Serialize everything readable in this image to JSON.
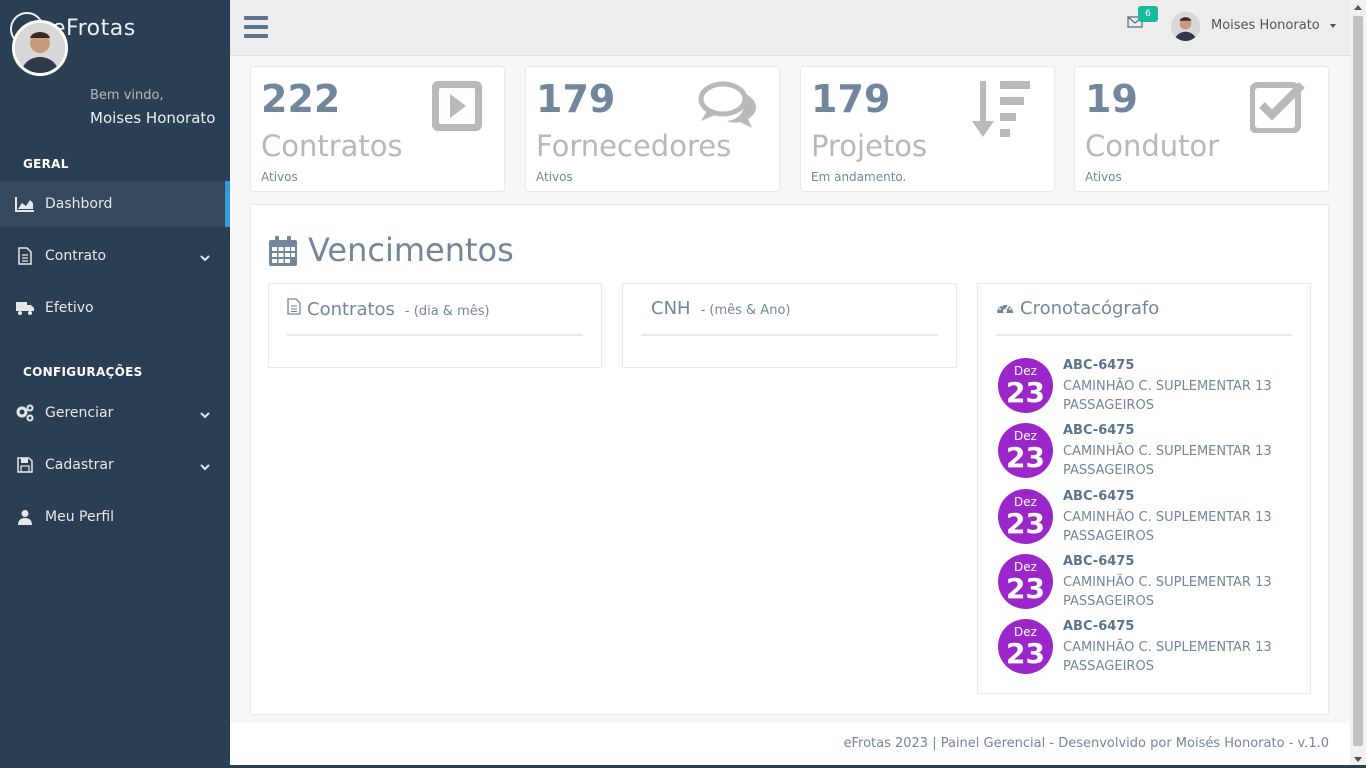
{
  "brand": {
    "name": "eFrotas"
  },
  "profile": {
    "welcome": "Bem vindo,",
    "name": "Moises Honorato"
  },
  "sidebar": {
    "sections": [
      {
        "title": "GERAL"
      },
      {
        "title": "CONFIGURAÇÕES"
      }
    ],
    "items": [
      {
        "label": "Dashbord",
        "icon": "area-chart-icon",
        "active": true
      },
      {
        "label": "Contrato",
        "icon": "file-icon",
        "has_submenu": true
      },
      {
        "label": "Efetivo",
        "icon": "truck-icon"
      },
      {
        "label": "Gerenciar",
        "icon": "cogs-icon",
        "has_submenu": true
      },
      {
        "label": "Cadastrar",
        "icon": "floppy-icon",
        "has_submenu": true
      },
      {
        "label": "Meu Perfil",
        "icon": "user-icon"
      }
    ]
  },
  "topnav": {
    "mail_count": "6",
    "user_name": "Moises Honorato"
  },
  "tiles": [
    {
      "count": "222",
      "label": "Contratos",
      "sub": "Ativos",
      "icon": "play-square-icon"
    },
    {
      "count": "179",
      "label": "Fornecedores",
      "sub": "Ativos",
      "icon": "comments-icon"
    },
    {
      "count": "179",
      "label": "Projetos",
      "sub": "Em andamento.",
      "icon": "sort-amount-icon"
    },
    {
      "count": "19",
      "label": "Condutor",
      "sub": "Ativos",
      "icon": "check-square-icon"
    }
  ],
  "vencimentos": {
    "title": "Vencimentos",
    "panels": [
      {
        "title": "Contratos",
        "note": "- (dia & mês)",
        "icon": "file-icon"
      },
      {
        "title": "CNH",
        "note": "- (mês & Ano)"
      },
      {
        "title": "Cronotacógrafo",
        "icon": "dashboard-icon"
      }
    ],
    "events": [
      {
        "month": "Dez",
        "day": "23",
        "plate": "ABC-6475",
        "desc": "CAMINHÃO C. SUPLEMENTAR 13 PASSAGEIROS"
      },
      {
        "month": "Dez",
        "day": "23",
        "plate": "ABC-6475",
        "desc": "CAMINHÃO C. SUPLEMENTAR 13 PASSAGEIROS"
      },
      {
        "month": "Dez",
        "day": "23",
        "plate": "ABC-6475",
        "desc": "CAMINHÃO C. SUPLEMENTAR 13 PASSAGEIROS"
      },
      {
        "month": "Dez",
        "day": "23",
        "plate": "ABC-6475",
        "desc": "CAMINHÃO C. SUPLEMENTAR 13 PASSAGEIROS"
      },
      {
        "month": "Dez",
        "day": "23",
        "plate": "ABC-6475",
        "desc": "CAMINHÃO C. SUPLEMENTAR 13 PASSAGEIROS"
      }
    ]
  },
  "footer": {
    "text": "eFrotas 2023 | Painel Gerencial - Desenvolvido por Moisés Honorato - v.1.0"
  },
  "colors": {
    "sidebar": "#2a3f54",
    "accent": "#1abb9c",
    "event_badge": "#9b26c9",
    "text": "#73879c"
  }
}
